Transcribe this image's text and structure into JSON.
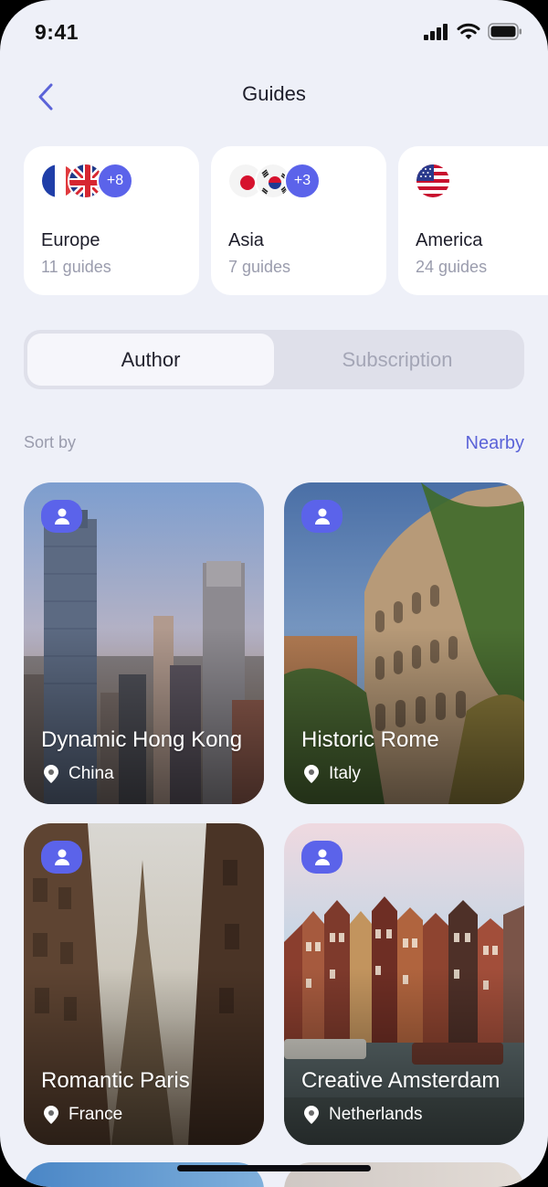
{
  "status_bar": {
    "time": "9:41"
  },
  "header": {
    "title": "Guides"
  },
  "regions": [
    {
      "name": "Europe",
      "count": "11 guides",
      "more": "+8"
    },
    {
      "name": "Asia",
      "count": "7 guides",
      "more": "+3"
    },
    {
      "name": "America",
      "count": "24 guides"
    }
  ],
  "tabs": {
    "active": "Author",
    "inactive": "Subscription"
  },
  "sort": {
    "label": "Sort by",
    "value": "Nearby"
  },
  "guides": [
    {
      "title": "Dynamic Hong Kong",
      "location": "China"
    },
    {
      "title": "Historic Rome",
      "location": "Italy"
    },
    {
      "title": "Romantic Paris",
      "location": "France"
    },
    {
      "title": "Creative Amsterdam",
      "location": "Netherlands"
    }
  ],
  "colors": {
    "accent": "#5b63ea",
    "background": "#eef0f8",
    "link": "#5b63d8"
  }
}
